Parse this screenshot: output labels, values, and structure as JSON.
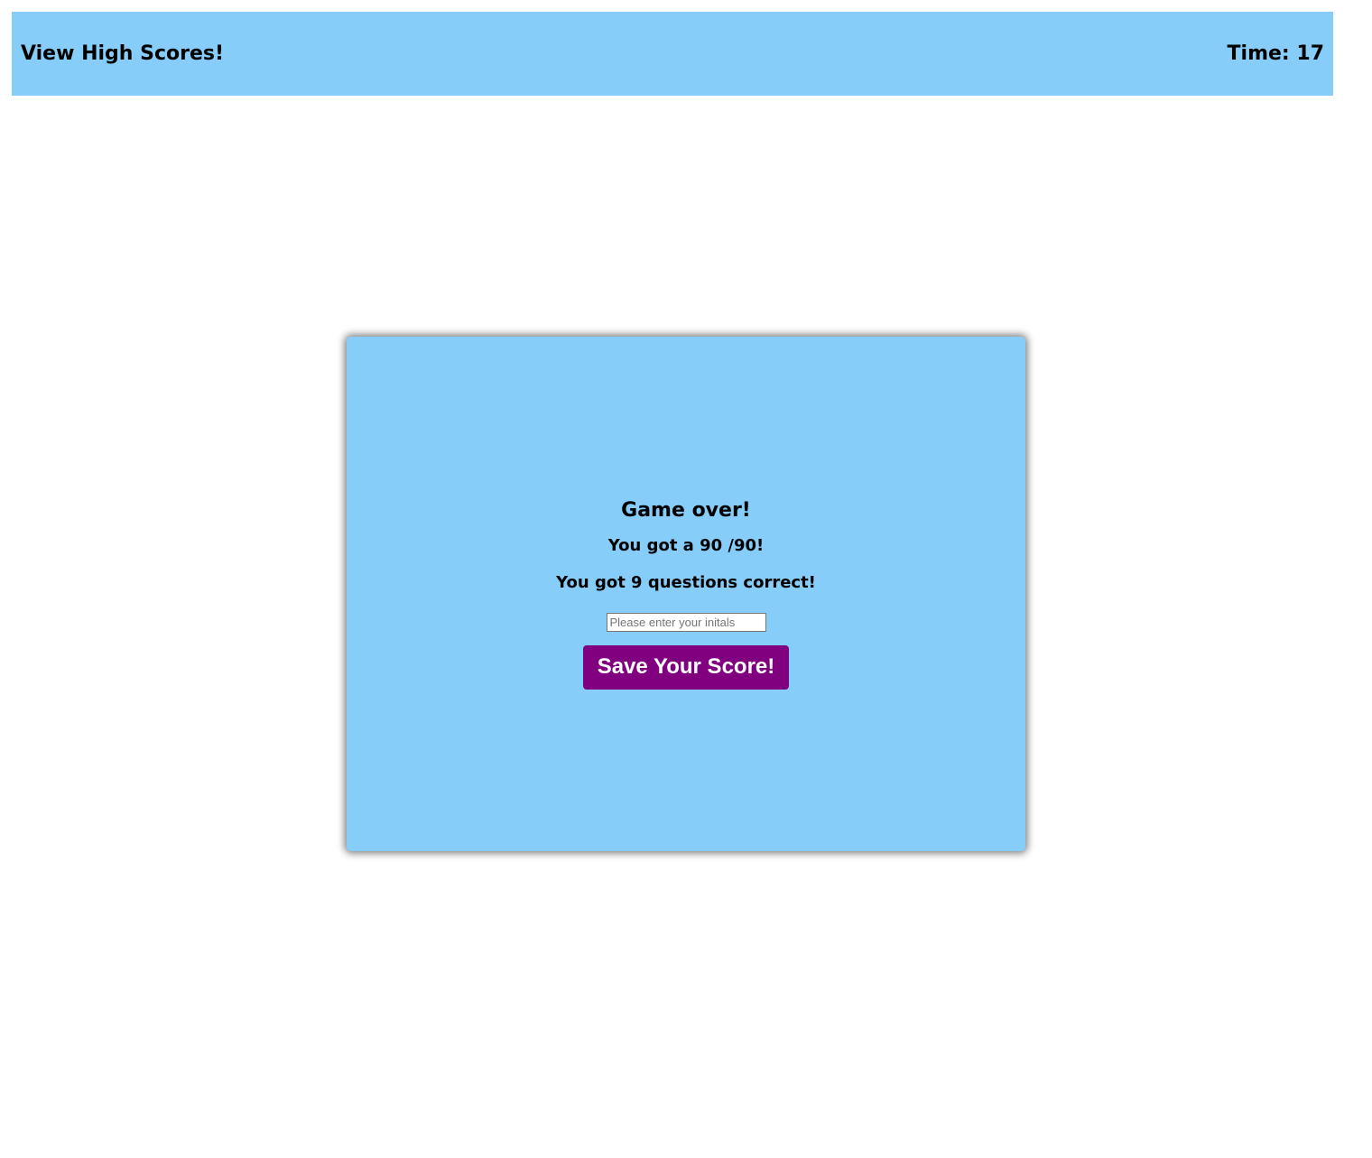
{
  "header": {
    "high_scores_link": "View High Scores!",
    "timer_label": "Time: 17"
  },
  "result": {
    "title": "Game over!",
    "score_text": "You got a 90 /90!",
    "correct_text": "You got 9 questions correct!",
    "initials_placeholder": "Please enter your initals",
    "save_button_label": "Save Your Score!"
  },
  "colors": {
    "panel_background": "#87cdf9",
    "button_background": "#800080",
    "button_text": "#ffffff",
    "text": "#000000"
  }
}
